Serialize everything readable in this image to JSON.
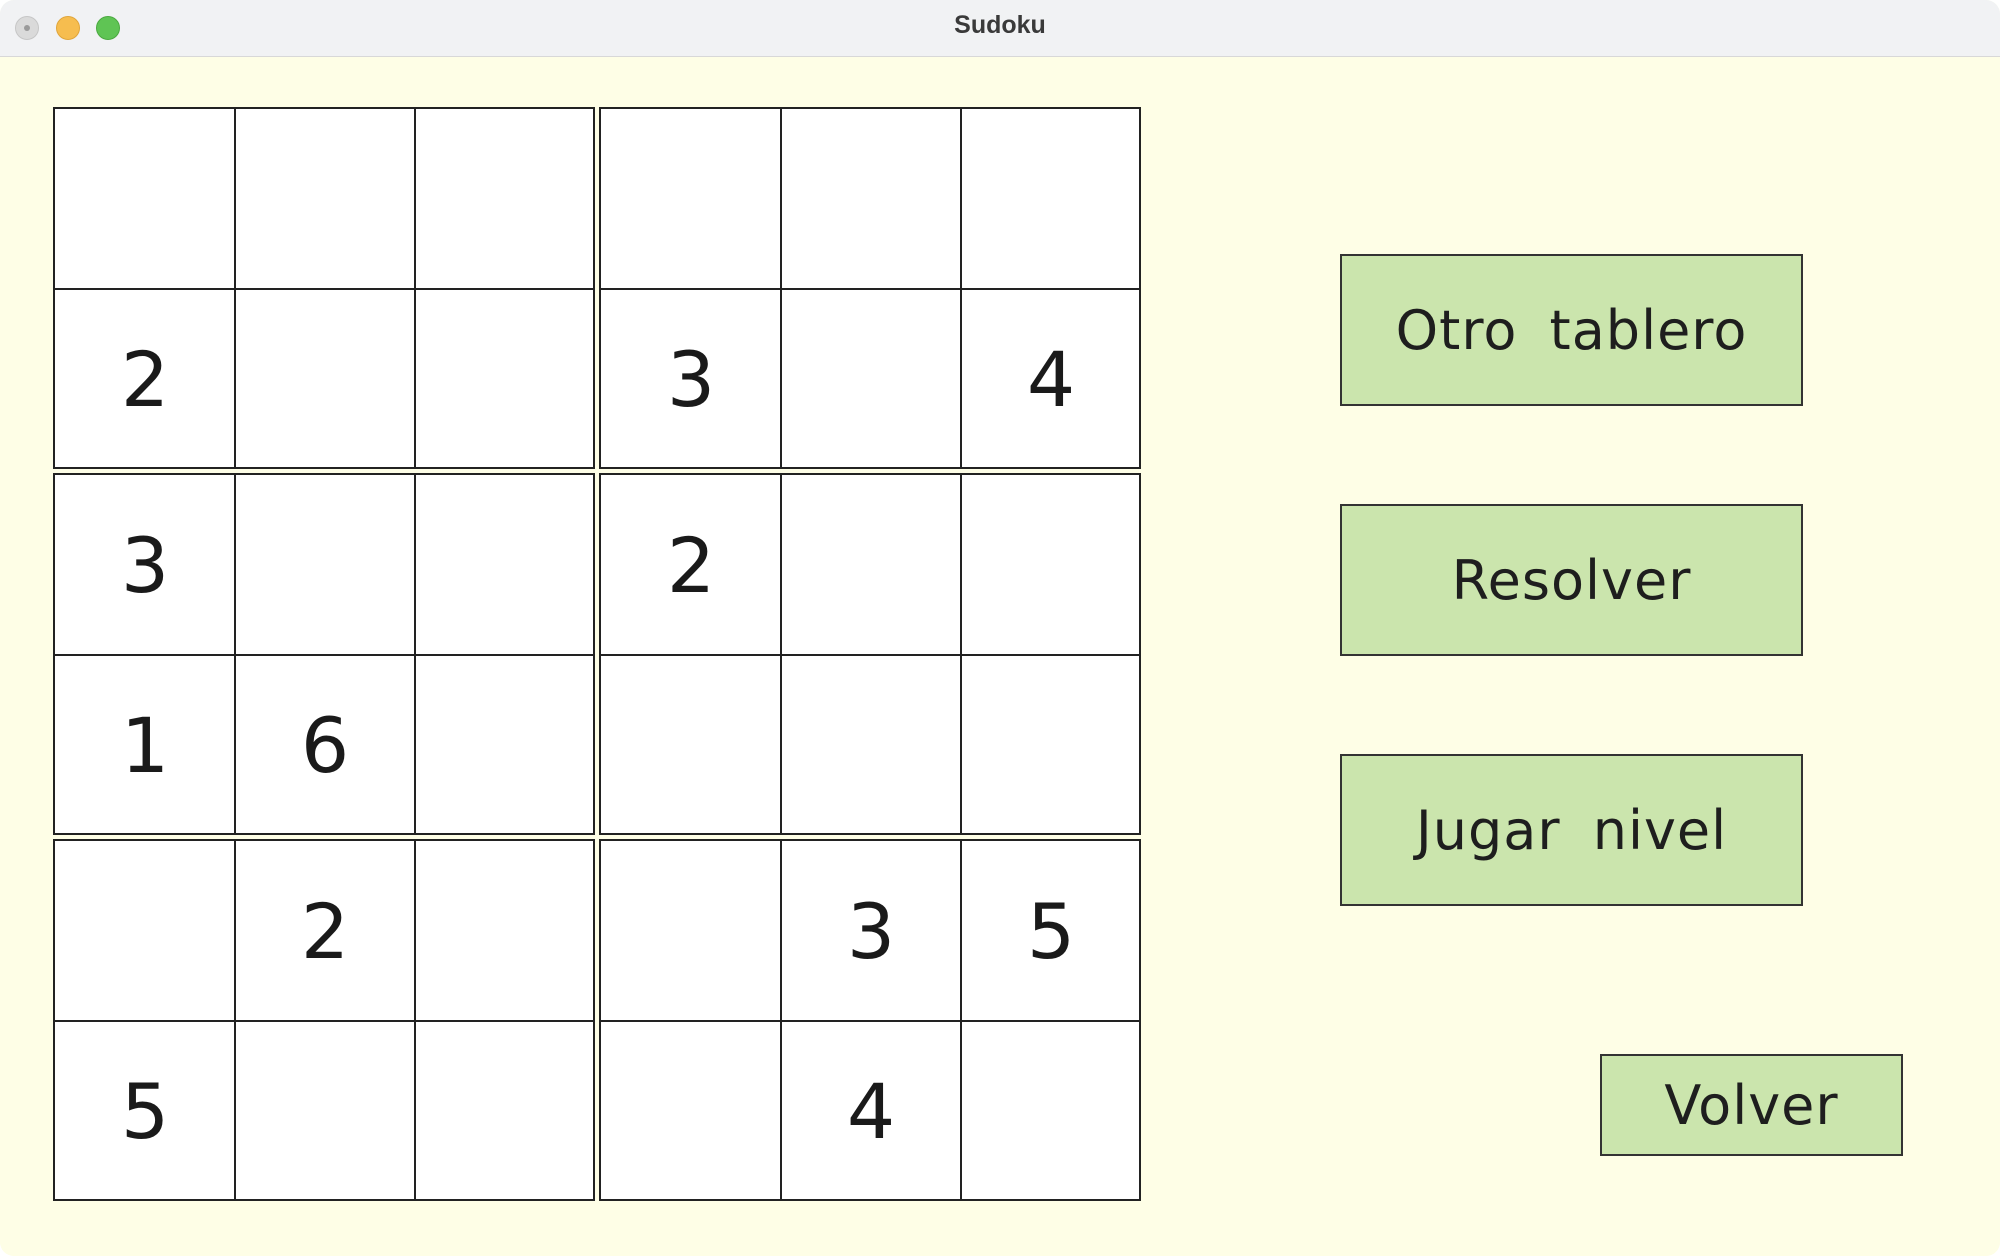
{
  "window": {
    "title": "Sudoku"
  },
  "board": {
    "rows": [
      [
        "",
        "",
        "",
        "",
        "",
        ""
      ],
      [
        "2",
        "",
        "",
        "3",
        "",
        "4"
      ],
      [
        "3",
        "",
        "",
        "2",
        "",
        ""
      ],
      [
        "1",
        "6",
        "",
        "",
        "",
        ""
      ],
      [
        "",
        "2",
        "",
        "",
        "3",
        "5"
      ],
      [
        "5",
        "",
        "",
        "",
        "4",
        ""
      ]
    ]
  },
  "buttons": {
    "new_board": "Otro tablero",
    "solve": "Resolver",
    "play_level": "Jugar nivel",
    "back": "Volver"
  },
  "colors": {
    "background": "#fefee6",
    "button": "#cbe5ad",
    "cell": "#ffffff",
    "grid_line": "#222222"
  }
}
